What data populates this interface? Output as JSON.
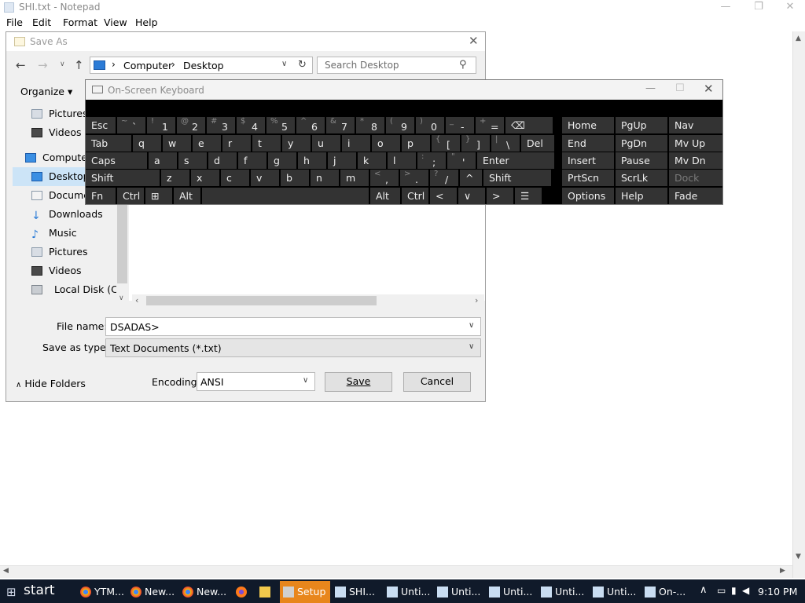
{
  "notepad": {
    "title": "SHI.txt - Notepad",
    "menu": [
      "File",
      "Edit",
      "Format",
      "View",
      "Help"
    ]
  },
  "save_dialog": {
    "title": "Save As",
    "address": {
      "segments": [
        "Computer",
        "Desktop"
      ]
    },
    "search_placeholder": "Search Desktop",
    "organize_label": "Organize",
    "nav_items": [
      {
        "label": "Pictures",
        "icon": "pictures-icon"
      },
      {
        "label": "Videos",
        "icon": "videos-icon"
      },
      {
        "label": "Computer",
        "icon": "computer-icon"
      },
      {
        "label": "Desktop",
        "icon": "desktop-icon",
        "selected": true
      },
      {
        "label": "Documen",
        "icon": "documents-icon"
      },
      {
        "label": "Downloads",
        "icon": "downloads-icon"
      },
      {
        "label": "Music",
        "icon": "music-icon"
      },
      {
        "label": "Pictures",
        "icon": "pictures-icon"
      },
      {
        "label": "Videos",
        "icon": "videos-icon"
      },
      {
        "label": "Local Disk (C:)",
        "icon": "disk-icon"
      }
    ],
    "file_name_label": "File name:",
    "file_name_value": "DSADAS>",
    "save_type_label": "Save as type:",
    "save_type_value": "Text Documents (*.txt)",
    "hide_folders_label": "Hide Folders",
    "encoding_label": "Encoding:",
    "encoding_value": "ANSI",
    "save_button": "Save",
    "cancel_button": "Cancel"
  },
  "osk": {
    "title": "On-Screen Keyboard",
    "rows": [
      [
        {
          "k": "Esc"
        },
        {
          "s": "~",
          "m": "`"
        },
        {
          "s": "!",
          "m": "1"
        },
        {
          "s": "@",
          "m": "2"
        },
        {
          "s": "#",
          "m": "3"
        },
        {
          "s": "$",
          "m": "4"
        },
        {
          "s": "%",
          "m": "5"
        },
        {
          "s": "^",
          "m": "6"
        },
        {
          "s": "&",
          "m": "7"
        },
        {
          "s": "*",
          "m": "8"
        },
        {
          "s": "(",
          "m": "9"
        },
        {
          "s": ")",
          "m": "0"
        },
        {
          "s": "_",
          "m": "-"
        },
        {
          "s": "+",
          "m": "="
        },
        {
          "k": "⌫"
        }
      ],
      [
        {
          "k": "Tab"
        },
        {
          "k": "q"
        },
        {
          "k": "w"
        },
        {
          "k": "e"
        },
        {
          "k": "r"
        },
        {
          "k": "t"
        },
        {
          "k": "y"
        },
        {
          "k": "u"
        },
        {
          "k": "i"
        },
        {
          "k": "o"
        },
        {
          "k": "p"
        },
        {
          "s": "{",
          "m": "["
        },
        {
          "s": "}",
          "m": "]"
        },
        {
          "s": "|",
          "m": "\\"
        },
        {
          "k": "Del"
        }
      ],
      [
        {
          "k": "Caps"
        },
        {
          "k": "a"
        },
        {
          "k": "s"
        },
        {
          "k": "d"
        },
        {
          "k": "f"
        },
        {
          "k": "g"
        },
        {
          "k": "h"
        },
        {
          "k": "j"
        },
        {
          "k": "k"
        },
        {
          "k": "l"
        },
        {
          "s": ":",
          "m": ";"
        },
        {
          "s": "\"",
          "m": "'"
        },
        {
          "k": "Enter"
        }
      ],
      [
        {
          "k": "Shift"
        },
        {
          "k": "z"
        },
        {
          "k": "x"
        },
        {
          "k": "c"
        },
        {
          "k": "v"
        },
        {
          "k": "b"
        },
        {
          "k": "n"
        },
        {
          "k": "m"
        },
        {
          "s": "<",
          "m": ","
        },
        {
          "s": ">",
          "m": "."
        },
        {
          "s": "?",
          "m": "/"
        },
        {
          "k": "^"
        },
        {
          "k": "Shift"
        }
      ],
      [
        {
          "k": "Fn"
        },
        {
          "k": "Ctrl"
        },
        {
          "k": "⊞"
        },
        {
          "k": "Alt"
        },
        {
          "k": ""
        },
        {
          "k": "Alt"
        },
        {
          "k": "Ctrl"
        },
        {
          "k": "<"
        },
        {
          "k": "∨"
        },
        {
          "k": ">"
        },
        {
          "k": "☰"
        }
      ]
    ],
    "side": [
      [
        "Home",
        "PgUp",
        "Nav"
      ],
      [
        "End",
        "PgDn",
        "Mv Up"
      ],
      [
        "Insert",
        "Pause",
        "Mv Dn"
      ],
      [
        "PrtScn",
        "ScrLk",
        "Dock"
      ],
      [
        "Options",
        "Help",
        "Fade"
      ]
    ]
  },
  "taskbar": {
    "start": "start",
    "items": [
      {
        "label": "YTM...",
        "icon": "chrome-icon"
      },
      {
        "label": "New...",
        "icon": "chrome-icon"
      },
      {
        "label": "New...",
        "icon": "chrome-icon"
      },
      {
        "label": "",
        "icon": "firefox-icon"
      },
      {
        "label": "",
        "icon": "folder-icon"
      },
      {
        "label": "Setup",
        "icon": "setup-icon",
        "active": true
      },
      {
        "label": "SHI...",
        "icon": "notepad-icon"
      },
      {
        "label": "Unti...",
        "icon": "notepad-icon"
      },
      {
        "label": "Unti...",
        "icon": "notepad-icon"
      },
      {
        "label": "Unti...",
        "icon": "notepad-icon"
      },
      {
        "label": "Unti...",
        "icon": "notepad-icon"
      },
      {
        "label": "Unti...",
        "icon": "notepad-icon"
      },
      {
        "label": "On-...",
        "icon": "keyboard-icon"
      }
    ],
    "clock": "9:10 PM"
  }
}
